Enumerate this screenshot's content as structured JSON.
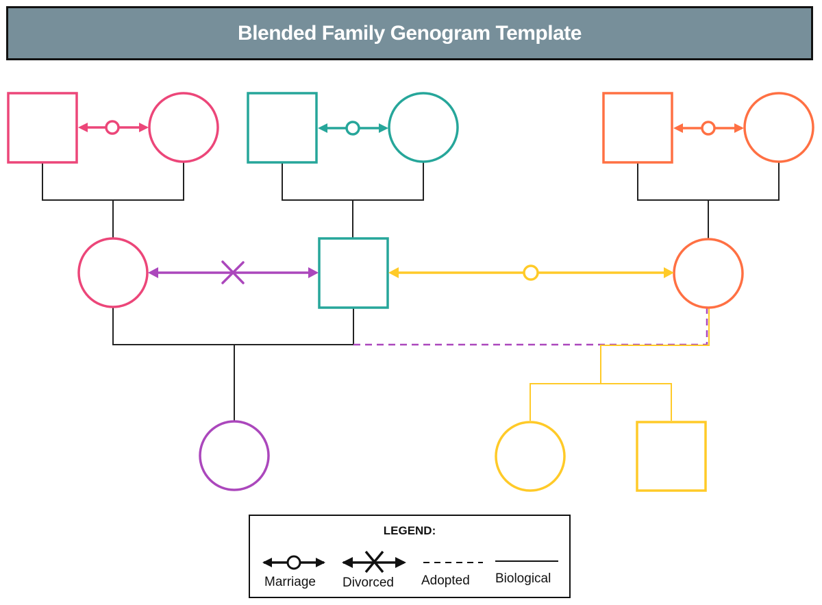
{
  "title": "Blended Family Genogram Template",
  "colors": {
    "pink": "#ec4679",
    "teal": "#26a69a",
    "orange": "#ff7043",
    "purple": "#ab47bc",
    "yellow": "#ffca28",
    "line": "#222222",
    "title_bg": "#778f9a"
  },
  "generations": {
    "grandparents": [
      {
        "id": "gp1-male",
        "shape": "square",
        "color": "pink"
      },
      {
        "id": "gp1-female",
        "shape": "circle",
        "color": "pink"
      },
      {
        "id": "gp2-male",
        "shape": "square",
        "color": "teal"
      },
      {
        "id": "gp2-female",
        "shape": "circle",
        "color": "teal"
      },
      {
        "id": "gp3-male",
        "shape": "square",
        "color": "orange"
      },
      {
        "id": "gp3-female",
        "shape": "circle",
        "color": "orange"
      }
    ],
    "parents": [
      {
        "id": "mother-1",
        "shape": "circle",
        "color": "pink"
      },
      {
        "id": "father",
        "shape": "square",
        "color": "teal"
      },
      {
        "id": "mother-2",
        "shape": "circle",
        "color": "orange"
      }
    ],
    "children": [
      {
        "id": "child-daughter-1",
        "shape": "circle",
        "color": "purple"
      },
      {
        "id": "child-daughter-2",
        "shape": "circle",
        "color": "yellow"
      },
      {
        "id": "child-son",
        "shape": "square",
        "color": "yellow"
      }
    ]
  },
  "relationships": [
    {
      "from": "gp1-male",
      "to": "gp1-female",
      "type": "marriage",
      "color": "pink"
    },
    {
      "from": "gp2-male",
      "to": "gp2-female",
      "type": "marriage",
      "color": "teal"
    },
    {
      "from": "gp3-male",
      "to": "gp3-female",
      "type": "marriage",
      "color": "orange"
    },
    {
      "from": "mother-1",
      "to": "father",
      "type": "divorced",
      "color": "purple"
    },
    {
      "from": "father",
      "to": "mother-2",
      "type": "marriage",
      "color": "yellow"
    }
  ],
  "legend": {
    "title": "LEGEND:",
    "items": [
      {
        "symbol": "marriage",
        "label": "Marriage"
      },
      {
        "symbol": "divorced",
        "label": "Divorced"
      },
      {
        "symbol": "adopted",
        "label": "Adopted"
      },
      {
        "symbol": "biological",
        "label": "Biological"
      }
    ]
  }
}
